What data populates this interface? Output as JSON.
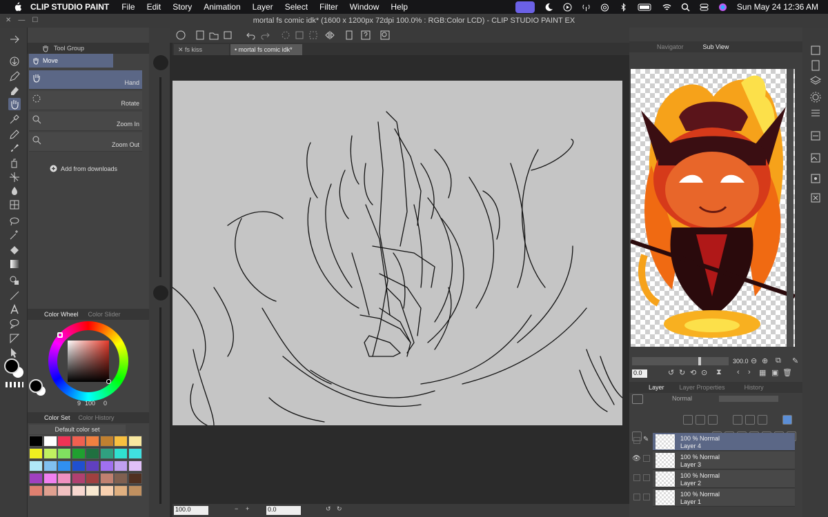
{
  "menubar": {
    "app": "CLIP STUDIO PAINT",
    "menus": [
      "File",
      "Edit",
      "Story",
      "Animation",
      "Layer",
      "Select",
      "Filter",
      "Window",
      "Help"
    ],
    "clock": "Sun May 24  12:36 AM"
  },
  "window": {
    "title": "mortal fs comic idk* (1600 x 1200px 72dpi 100.0% : RGB:Color LCD)  - CLIP STUDIO PAINT EX"
  },
  "tabs": [
    {
      "label": "fs kiss"
    },
    {
      "label": "mortal fs comic idk*"
    }
  ],
  "tool_panel": {
    "header": "Tool Group",
    "group": "Move",
    "subtools": [
      {
        "label": "Hand",
        "selected": true
      },
      {
        "label": "Rotate",
        "selected": false
      },
      {
        "label": "Zoom In",
        "selected": false
      },
      {
        "label": "Zoom Out",
        "selected": false
      }
    ],
    "add_downloads": "Add from downloads"
  },
  "color_panel": {
    "tab1": "Color Wheel",
    "tab2": "Color Slider",
    "hsv_readout": {
      "h": "9",
      "s": "100",
      "v": "0"
    }
  },
  "colorset": {
    "tab1": "Color Set",
    "tab2": "Color History",
    "set_name": "Default color set",
    "swatches": [
      "#000000",
      "#ffffff",
      "#ee3355",
      "#f06050",
      "#f08040",
      "#c08030",
      "#f8c040",
      "#f8e8a0",
      "#f0f020",
      "#c0f060",
      "#80e060",
      "#20a030",
      "#207040",
      "#30a080",
      "#30e0d0",
      "#40e0e0",
      "#b0e8f8",
      "#80c0f0",
      "#3090f0",
      "#2050d0",
      "#6040c0",
      "#a070f0",
      "#c0a0f0",
      "#e0c0f8",
      "#a040c0",
      "#f080f0",
      "#f090c0",
      "#b04070",
      "#a04040",
      "#c08070",
      "#806050",
      "#503020",
      "#e08070",
      "#e0a090",
      "#f0c0c0",
      "#f8d8d0",
      "#f8e8d0",
      "#f8d0b0",
      "#e0b080",
      "#c09060"
    ]
  },
  "zoom_bar": {
    "zoom": "100.0",
    "angle": "0.0"
  },
  "navigator": {
    "tab1": "Navigator",
    "tab2": "Sub View",
    "zoom": "300.0",
    "angle": "0.0"
  },
  "layer_panel": {
    "tab1": "Layer",
    "tab2": "Layer Properties",
    "tab3": "History",
    "blend": "Normal",
    "layers": [
      {
        "opacity": "100 %",
        "mode": "Normal",
        "name": "Layer 4",
        "selected": true,
        "visible": false
      },
      {
        "opacity": "100 %",
        "mode": "Normal",
        "name": "Layer 3",
        "selected": false,
        "visible": true
      },
      {
        "opacity": "100 %",
        "mode": "Normal",
        "name": "Layer 2",
        "selected": false,
        "visible": false
      },
      {
        "opacity": "100 %",
        "mode": "Normal",
        "name": "Layer 1",
        "selected": false,
        "visible": false
      }
    ]
  },
  "colors": {
    "selection": "#5b6786",
    "accent": "#6b61e6",
    "canvas": "#c5c5c5"
  }
}
